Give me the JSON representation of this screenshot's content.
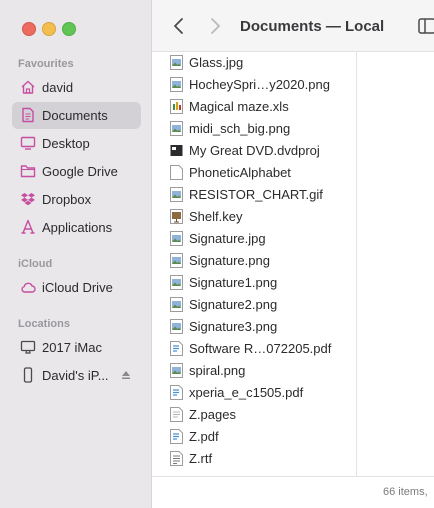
{
  "window": {
    "title": "Documents — Local"
  },
  "sidebar": {
    "sections": [
      {
        "title": "Favourites",
        "items": [
          {
            "label": "david",
            "icon": "home-icon"
          },
          {
            "label": "Documents",
            "icon": "document-icon",
            "selected": true
          },
          {
            "label": "Desktop",
            "icon": "desktop-icon"
          },
          {
            "label": "Google Drive",
            "icon": "folder-icon"
          },
          {
            "label": "Dropbox",
            "icon": "dropbox-icon"
          },
          {
            "label": "Applications",
            "icon": "applications-icon"
          }
        ]
      },
      {
        "title": "iCloud",
        "items": [
          {
            "label": "iCloud Drive",
            "icon": "cloud-icon"
          }
        ]
      },
      {
        "title": "Locations",
        "items": [
          {
            "label": "2017 iMac",
            "icon": "imac-icon"
          },
          {
            "label": "David's iP...",
            "icon": "iphone-icon"
          }
        ]
      }
    ]
  },
  "files": [
    {
      "name": "Glass.jpg",
      "icon": "image-file-icon"
    },
    {
      "name": "HocheySpri…y2020.png",
      "icon": "image-file-icon"
    },
    {
      "name": "Magical maze.xls",
      "icon": "spreadsheet-file-icon"
    },
    {
      "name": "midi_sch_big.png",
      "icon": "image-file-icon"
    },
    {
      "name": "My Great DVD.dvdproj",
      "icon": "dvd-project-icon"
    },
    {
      "name": "PhoneticAlphabet",
      "icon": "document-file-icon"
    },
    {
      "name": "RESISTOR_CHART.gif",
      "icon": "image-file-icon"
    },
    {
      "name": "Shelf.key",
      "icon": "keynote-file-icon"
    },
    {
      "name": "Signature.jpg",
      "icon": "image-file-icon"
    },
    {
      "name": "Signature.png",
      "icon": "image-file-icon"
    },
    {
      "name": "Signature1.png",
      "icon": "image-file-icon"
    },
    {
      "name": "Signature2.png",
      "icon": "image-file-icon"
    },
    {
      "name": "Signature3.png",
      "icon": "image-file-icon"
    },
    {
      "name": "Software R…072205.pdf",
      "icon": "pdf-file-icon"
    },
    {
      "name": "spiral.png",
      "icon": "image-file-icon"
    },
    {
      "name": "xperia_e_c1505.pdf",
      "icon": "pdf-file-icon"
    },
    {
      "name": "Z.pages",
      "icon": "pages-file-icon"
    },
    {
      "name": "Z.pdf",
      "icon": "pdf-file-icon"
    },
    {
      "name": "Z.rtf",
      "icon": "rtf-file-icon"
    }
  ],
  "statusbar": {
    "text": "66 items,"
  },
  "colors": {
    "accent": "#c54fa0",
    "sidebar_bg": "#e9e7ea",
    "selected_bg": "#d3d1d5"
  }
}
